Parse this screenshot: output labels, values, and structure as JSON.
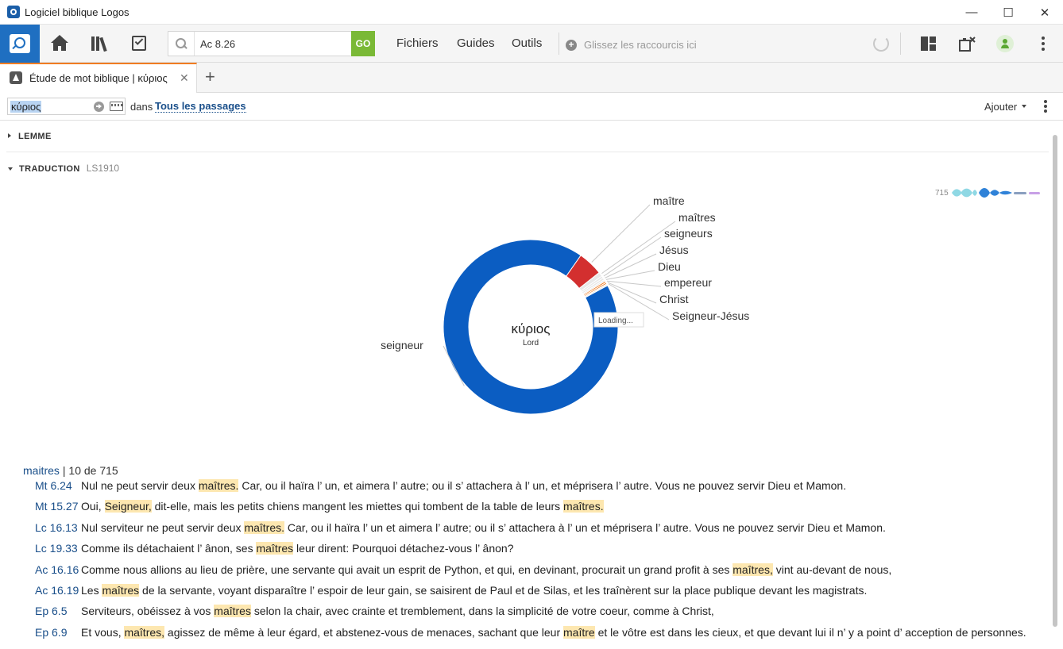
{
  "window": {
    "title": "Logiciel biblique Logos",
    "controls": [
      "—",
      "☐",
      "✕"
    ]
  },
  "toolbar": {
    "search_value": "Ac 8.26",
    "go_label": "GO",
    "menus": [
      "Fichiers",
      "Guides",
      "Outils"
    ],
    "shortcuts_placeholder": "Glissez les raccourcis ici"
  },
  "tab": {
    "label": "Étude de mot biblique | κύριος",
    "close": "✕",
    "add": "+"
  },
  "filter": {
    "word": "κύριος",
    "in_label": "dans",
    "scope": "Tous les passages",
    "add_label": "Ajouter"
  },
  "sections": {
    "lemme": "LEMME",
    "traduction": "TRADUCTION",
    "version": "LS1910"
  },
  "mini_graph": {
    "count": "715"
  },
  "chart_data": {
    "type": "pie",
    "center_label": "κύριος",
    "center_sub": "Lord",
    "loading_text": "Loading...",
    "slices": [
      {
        "label": "seigneur",
        "value": 92.6,
        "color": "#0b5dc2"
      },
      {
        "label": "maître",
        "value": 4.6,
        "color": "#d32f2f"
      },
      {
        "label": "maîtres",
        "value": 0.8,
        "color": "#e8e8e8"
      },
      {
        "label": "seigneurs",
        "value": 0.4,
        "color": "#e8e8e8"
      },
      {
        "label": "Jésus",
        "value": 0.4,
        "color": "#e8e8e8"
      },
      {
        "label": "Dieu",
        "value": 0.3,
        "color": "#e8e8e8"
      },
      {
        "label": "empereur",
        "value": 0.3,
        "color": "#f07c22"
      },
      {
        "label": "Christ",
        "value": 0.3,
        "color": "#f07c22"
      },
      {
        "label": "Seigneur-Jésus",
        "value": 0.3,
        "color": "#e8e8e8"
      }
    ]
  },
  "results": {
    "word": "maitres",
    "count": "| 10 de 715",
    "rows": [
      {
        "ref": "Mt 6.24",
        "parts": [
          [
            "Nul ne peut servir deux ",
            false
          ],
          [
            "maîtres.",
            true
          ],
          [
            " Car, ou il haïra l’ un, et aimera l’ autre; ou il s’ attachera à l’ un, et méprisera l’ autre. Vous ne pouvez servir Dieu et Mamon.",
            false
          ]
        ]
      },
      {
        "ref": "Mt 15.27",
        "parts": [
          [
            "Oui, ",
            false
          ],
          [
            "Seigneur,",
            true
          ],
          [
            " dit-elle, mais les petits chiens mangent les miettes qui tombent de la table de leurs ",
            false
          ],
          [
            "maîtres.",
            true
          ]
        ]
      },
      {
        "ref": "Lc 16.13",
        "parts": [
          [
            "Nul serviteur ne peut servir deux ",
            false
          ],
          [
            "maîtres.",
            true
          ],
          [
            " Car, ou il haïra l’ un et aimera l’ autre; ou il s’ attachera à l’ un et méprisera l’ autre. Vous ne pouvez servir Dieu et Mamon.",
            false
          ]
        ]
      },
      {
        "ref": "Lc 19.33",
        "parts": [
          [
            "Comme ils détachaient l’ ânon, ses ",
            false
          ],
          [
            "maîtres",
            true
          ],
          [
            " leur dirent: Pourquoi détachez-vous l’ ânon?",
            false
          ]
        ]
      },
      {
        "ref": "Ac 16.16",
        "parts": [
          [
            "Comme nous allions au lieu de prière, une servante qui avait un esprit de Python, et qui, en devinant, procurait un grand profit à ses ",
            false
          ],
          [
            "maîtres,",
            true
          ],
          [
            " vint au-devant de nous,",
            false
          ]
        ]
      },
      {
        "ref": "Ac 16.19",
        "parts": [
          [
            "Les ",
            false
          ],
          [
            "maîtres",
            true
          ],
          [
            " de la servante, voyant disparaître l’ espoir de leur gain, se saisirent de Paul et de Silas, et les traînèrent sur la place publique devant les magistrats.",
            false
          ]
        ]
      },
      {
        "ref": "Ep 6.5",
        "parts": [
          [
            "Serviteurs, obéissez à vos ",
            false
          ],
          [
            "maîtres",
            true
          ],
          [
            " selon la chair, avec crainte et tremblement, dans la simplicité de votre coeur, comme à Christ,",
            false
          ]
        ]
      },
      {
        "ref": "Ep 6.9",
        "parts": [
          [
            "Et vous, ",
            false
          ],
          [
            "maîtres,",
            true
          ],
          [
            " agissez de même à leur égard, et abstenez-vous de menaces, sachant que leur ",
            false
          ],
          [
            "maître",
            true
          ],
          [
            " et le vôtre est dans les cieux, et que devant lui il n’ y a point d’ acception de personnes.",
            false
          ]
        ]
      }
    ]
  }
}
